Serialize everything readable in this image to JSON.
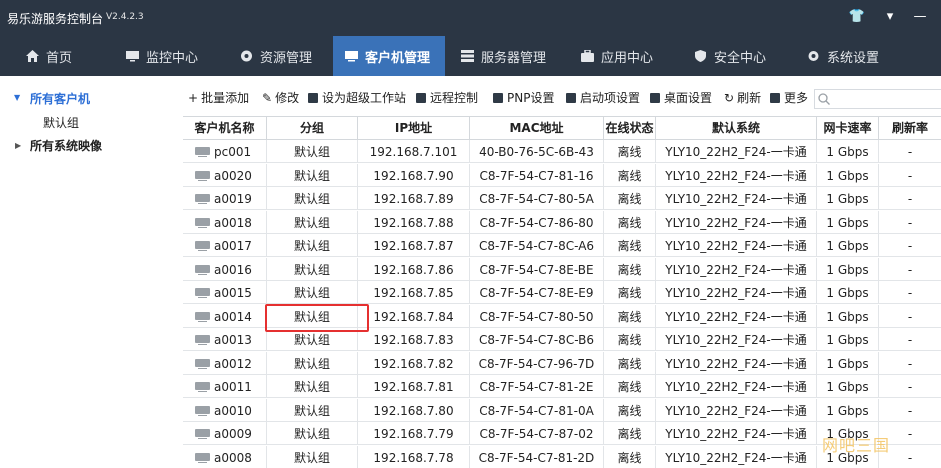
{
  "app": {
    "title": "易乐游服务控制台",
    "version": "V2.4.2.3",
    "window_controls": {
      "skin": "👕",
      "menu": "▾",
      "minimize": "—"
    }
  },
  "nav": {
    "tabs": [
      {
        "label": "首页",
        "icon": "home-icon"
      },
      {
        "label": "监控中心",
        "icon": "monitor-icon"
      },
      {
        "label": "资源管理",
        "icon": "resource-icon"
      },
      {
        "label": "客户机管理",
        "icon": "client-icon",
        "active": true
      },
      {
        "label": "服务器管理",
        "icon": "server-icon"
      },
      {
        "label": "应用中心",
        "icon": "app-icon"
      },
      {
        "label": "安全中心",
        "icon": "shield-icon"
      },
      {
        "label": "系统设置",
        "icon": "gear-icon"
      }
    ]
  },
  "sidebar": {
    "root": {
      "label": "所有客户机",
      "caret": "▼"
    },
    "child": {
      "label": "默认组"
    },
    "images": {
      "label": "所有系统映像",
      "caret": "▶"
    }
  },
  "toolbar": {
    "items": [
      {
        "glyph": "+",
        "label": "批量添加"
      },
      {
        "glyph": "✎",
        "label": "修改"
      },
      {
        "glyph": "",
        "label": "设为超级工作站"
      },
      {
        "glyph": "",
        "label": "远程控制"
      },
      {
        "glyph": "",
        "label": "PNP设置"
      },
      {
        "glyph": "",
        "label": "启动项设置"
      },
      {
        "glyph": "",
        "label": "桌面设置"
      },
      {
        "glyph": "↻",
        "label": "刷新"
      },
      {
        "glyph": "",
        "label": "更多"
      }
    ],
    "search_placeholder": ""
  },
  "table": {
    "headers": [
      "客户机名称",
      "分组",
      "IP地址",
      "MAC地址",
      "在线状态",
      "默认系统",
      "网卡速率",
      "刷新率"
    ],
    "rows": [
      {
        "name": "pc001",
        "group": "默认组",
        "ip": "192.168.7.101",
        "mac": "40-B0-76-5C-6B-43",
        "status": "离线",
        "os": "YLY10_22H2_F24-一卡通",
        "speed": "1 Gbps",
        "refresh": "-"
      },
      {
        "name": "a0020",
        "group": "默认组",
        "ip": "192.168.7.90",
        "mac": "C8-7F-54-C7-81-16",
        "status": "离线",
        "os": "YLY10_22H2_F24-一卡通",
        "speed": "1 Gbps",
        "refresh": "-"
      },
      {
        "name": "a0019",
        "group": "默认组",
        "ip": "192.168.7.89",
        "mac": "C8-7F-54-C7-80-5A",
        "status": "离线",
        "os": "YLY10_22H2_F24-一卡通",
        "speed": "1 Gbps",
        "refresh": "-"
      },
      {
        "name": "a0018",
        "group": "默认组",
        "ip": "192.168.7.88",
        "mac": "C8-7F-54-C7-86-80",
        "status": "离线",
        "os": "YLY10_22H2_F24-一卡通",
        "speed": "1 Gbps",
        "refresh": "-"
      },
      {
        "name": "a0017",
        "group": "默认组",
        "ip": "192.168.7.87",
        "mac": "C8-7F-54-C7-8C-A6",
        "status": "离线",
        "os": "YLY10_22H2_F24-一卡通",
        "speed": "1 Gbps",
        "refresh": "-"
      },
      {
        "name": "a0016",
        "group": "默认组",
        "ip": "192.168.7.86",
        "mac": "C8-7F-54-C7-8E-BE",
        "status": "离线",
        "os": "YLY10_22H2_F24-一卡通",
        "speed": "1 Gbps",
        "refresh": "-"
      },
      {
        "name": "a0015",
        "group": "默认组",
        "ip": "192.168.7.85",
        "mac": "C8-7F-54-C7-8E-E9",
        "status": "离线",
        "os": "YLY10_22H2_F24-一卡通",
        "speed": "1 Gbps",
        "refresh": "-"
      },
      {
        "name": "a0014",
        "group": "默认组",
        "ip": "192.168.7.84",
        "mac": "C8-7F-54-C7-80-50",
        "status": "离线",
        "os": "YLY10_22H2_F24-一卡通",
        "speed": "1 Gbps",
        "refresh": "-"
      },
      {
        "name": "a0013",
        "group": "默认组",
        "ip": "192.168.7.83",
        "mac": "C8-7F-54-C7-8C-B6",
        "status": "离线",
        "os": "YLY10_22H2_F24-一卡通",
        "speed": "1 Gbps",
        "refresh": "-"
      },
      {
        "name": "a0012",
        "group": "默认组",
        "ip": "192.168.7.82",
        "mac": "C8-7F-54-C7-96-7D",
        "status": "离线",
        "os": "YLY10_22H2_F24-一卡通",
        "speed": "1 Gbps",
        "refresh": "-"
      },
      {
        "name": "a0011",
        "group": "默认组",
        "ip": "192.168.7.81",
        "mac": "C8-7F-54-C7-81-2E",
        "status": "离线",
        "os": "YLY10_22H2_F24-一卡通",
        "speed": "1 Gbps",
        "refresh": "-"
      },
      {
        "name": "a0010",
        "group": "默认组",
        "ip": "192.168.7.80",
        "mac": "C8-7F-54-C7-81-0A",
        "status": "离线",
        "os": "YLY10_22H2_F24-一卡通",
        "speed": "1 Gbps",
        "refresh": "-"
      },
      {
        "name": "a0009",
        "group": "默认组",
        "ip": "192.168.7.79",
        "mac": "C8-7F-54-C7-87-02",
        "status": "离线",
        "os": "YLY10_22H2_F24-一卡通",
        "speed": "1 Gbps",
        "refresh": "-"
      },
      {
        "name": "a0008",
        "group": "默认组",
        "ip": "192.168.7.78",
        "mac": "C8-7F-54-C7-81-2D",
        "status": "离线",
        "os": "YLY10_22H2_F24-一卡通",
        "speed": "1 Gbps",
        "refresh": "-"
      }
    ]
  },
  "watermark": {
    "text": "网吧三国"
  },
  "colors": {
    "titlebar": "#2b3644",
    "active_tab": "#3a72b8",
    "tree_selected": "#2d6fd6",
    "highlight_box": "#e53030"
  }
}
